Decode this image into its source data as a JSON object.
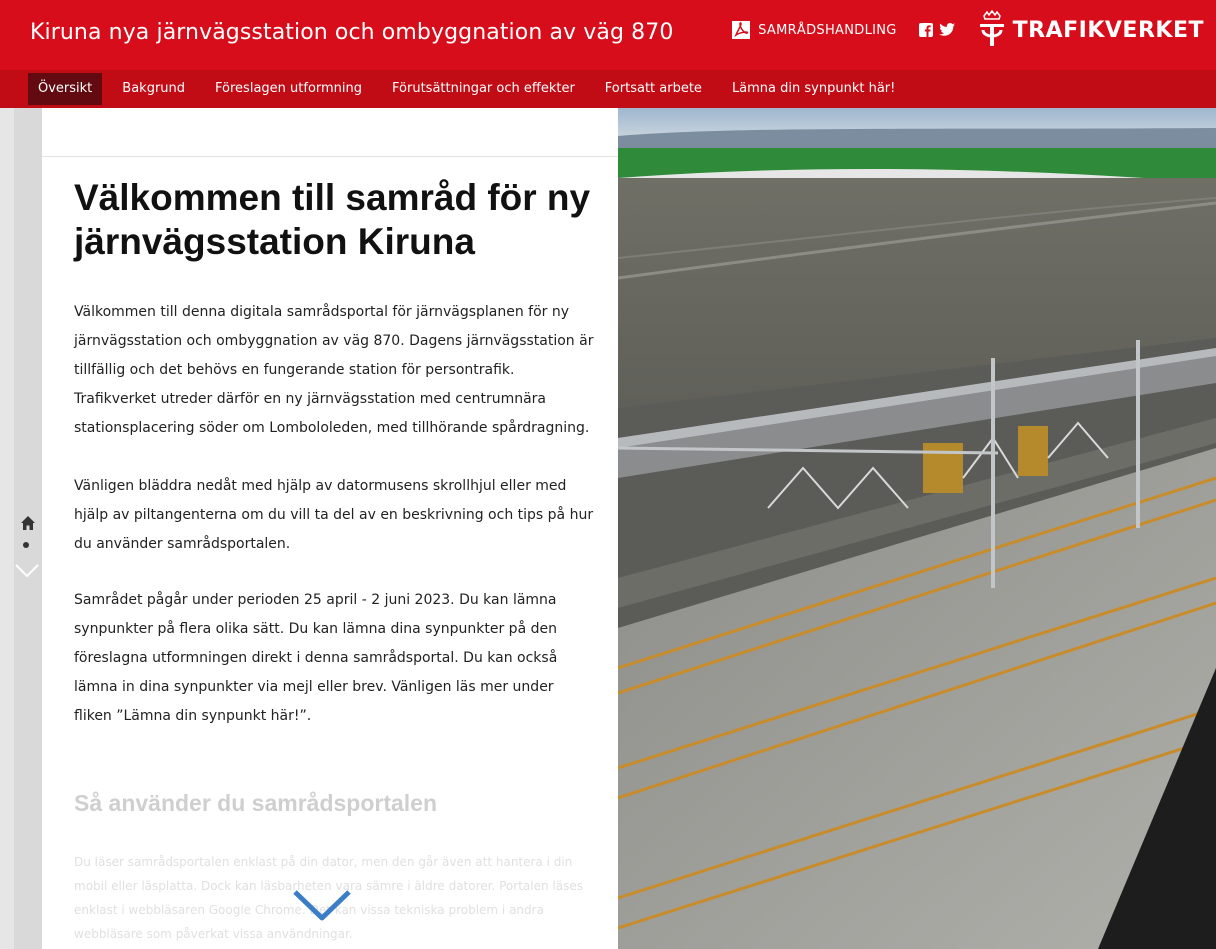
{
  "header": {
    "title": "Kiruna nya järnvägsstation och ombyggnation av väg 870",
    "document_link": "SAMRÅDSHANDLING",
    "brand": "TRAFIKVERKET",
    "accent_color": "#d80d1b",
    "icons": [
      "pdf-icon",
      "facebook-icon",
      "twitter-icon",
      "crown-logo-icon"
    ]
  },
  "nav": {
    "items": [
      {
        "label": "Översikt",
        "active": true
      },
      {
        "label": "Bakgrund",
        "active": false
      },
      {
        "label": "Föreslagen utformning",
        "active": false
      },
      {
        "label": "Förutsättningar och effekter",
        "active": false
      },
      {
        "label": "Fortsatt arbete",
        "active": false
      },
      {
        "label": "Lämna din synpunkt här!",
        "active": false
      }
    ]
  },
  "rail": {
    "icons": [
      "home-icon",
      "dot-indicator",
      "chevron-down-icon"
    ]
  },
  "content": {
    "heading": "Välkommen till samråd för ny järnvägsstation Kiruna",
    "paragraphs": [
      "Välkommen till denna digitala samrådsportal för järnvägsplanen för ny järnvägsstation och ombyggnation av väg 870. Dagens järnvägsstation är tillfällig och det behövs en fungerande station för persontrafik. Trafikverket utreder därför en ny järnvägsstation med centrumnära stationsplacering söder om Lombololeden, med tillhörande spårdragning.",
      "Vänligen bläddra nedåt med hjälp av datormusens skrollhjul eller med hjälp av piltangenterna om du vill ta del av en beskrivning och tips på hur du använder samrådsportalen.",
      "Samrådet pågår under perioden 25 april - 2 juni 2023. Du kan lämna synpunkter på flera olika sätt. Du kan lämna dina synpunkter på den föreslagna utformningen direkt i denna samrådsportal. Du kan också lämna in dina synpunkter via mejl eller brev. Vänligen läs mer under fliken ”Lämna din synpunkt här!”."
    ],
    "subheading": "Så använder du samrådsportalen",
    "faded_paragraph": "Du läser samrådsportalen enklast på din dator, men den går även att hantera i din mobil eller läsplatta. Dock kan läsbarheten vara sämre i äldre datorer. Portalen läses enklast i webbläsaren Google Chrome. Det kan vissa tekniska problem i andra webbläsare som påverkat vissa användningar."
  },
  "scene": {
    "description_icon": "station-render-image"
  }
}
